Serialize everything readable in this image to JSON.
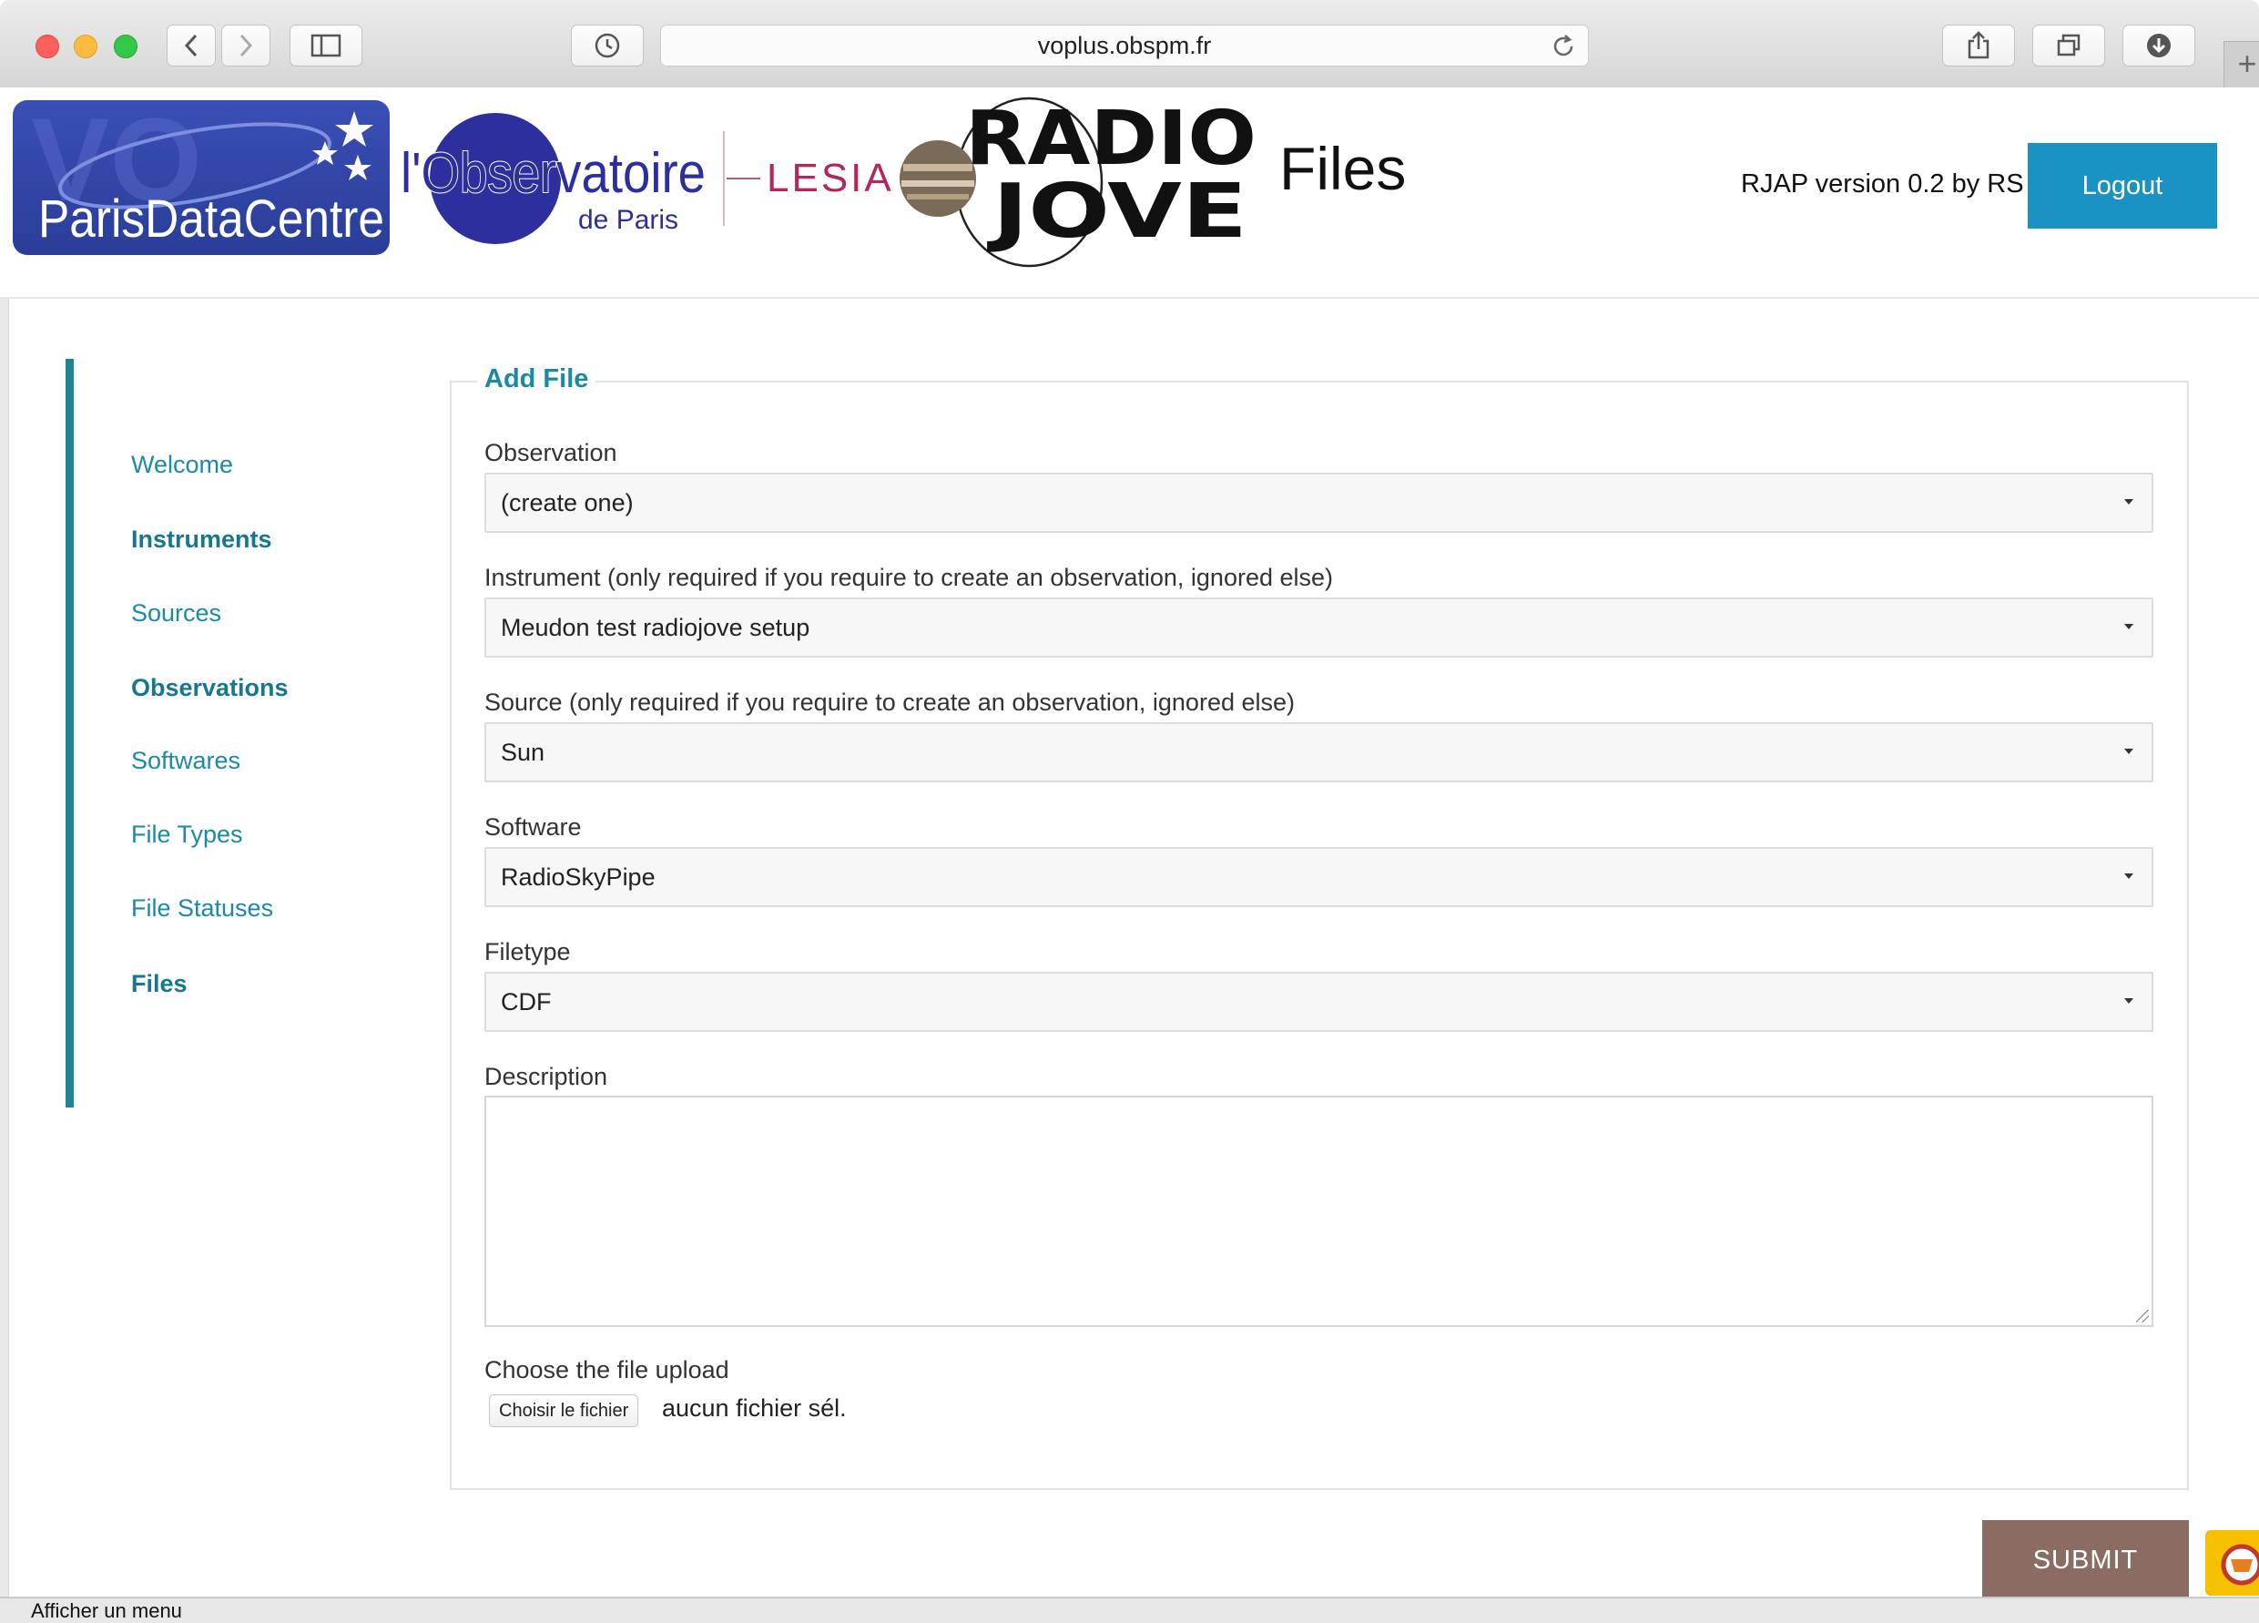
{
  "browser": {
    "url": "voplus.obspm.fr"
  },
  "header": {
    "logos": {
      "pdc_text": "ParisDataCentre",
      "obs_line1": "l'Observatoire",
      "obs_line2": "de Paris",
      "lesia": "LESIA",
      "jove_line1": "RADIO",
      "jove_line2": "JOVE"
    },
    "app_name": "Files",
    "version": "RJAP version 0.2 by RS",
    "logout_label": "Logout"
  },
  "sidebar": {
    "items": [
      {
        "label": "Welcome",
        "bold": false
      },
      {
        "label": "Instruments",
        "bold": true
      },
      {
        "label": "Sources",
        "bold": false
      },
      {
        "label": "Observations",
        "bold": true
      },
      {
        "label": "Softwares",
        "bold": false
      },
      {
        "label": "File Types",
        "bold": false
      },
      {
        "label": "File Statuses",
        "bold": false
      },
      {
        "label": "Files",
        "bold": true
      }
    ]
  },
  "form": {
    "legend": "Add File",
    "observation": {
      "label": "Observation",
      "value": "(create one)"
    },
    "instrument": {
      "label": "Instrument (only required if you require to create an observation, ignored else)",
      "value": "Meudon test radiojove setup"
    },
    "source": {
      "label": "Source (only required if you require to create an observation, ignored else)",
      "value": "Sun"
    },
    "software": {
      "label": "Software",
      "value": "RadioSkyPipe"
    },
    "filetype": {
      "label": "Filetype",
      "value": "CDF"
    },
    "description": {
      "label": "Description",
      "value": ""
    },
    "upload": {
      "label": "Choose the file upload",
      "button_label": "Choisir le fichier",
      "status": "aucun fichier sél."
    },
    "submit_label": "SUBMIT"
  },
  "statusbar": {
    "text": "Afficher un menu"
  },
  "colors": {
    "accent": "#1a8aa3",
    "logout": "#1a93c4",
    "submit": "#8a6c62",
    "sidebar_bar": "#1f8496"
  }
}
